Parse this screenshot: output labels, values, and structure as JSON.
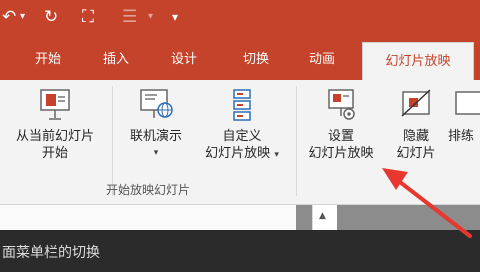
{
  "quick_access": {
    "undo_icon": "↶",
    "menu_caret": "▾",
    "redo_icon": "↻",
    "present_icon": "⛶",
    "list_icon": "☰",
    "customize_icon": "▾"
  },
  "tabs": [
    {
      "label": "开始"
    },
    {
      "label": "插入"
    },
    {
      "label": "设计"
    },
    {
      "label": "切换"
    },
    {
      "label": "动画"
    },
    {
      "label": "幻灯片放映",
      "active": true
    }
  ],
  "ribbon": {
    "from_current": {
      "line1": "从当前幻灯片",
      "line2": "开始"
    },
    "online": {
      "line1": "联机演示",
      "caret": "▾"
    },
    "custom": {
      "line1": "自定义",
      "line2": "幻灯片放映",
      "caret": "▾"
    },
    "setup": {
      "line1": "设置",
      "line2": "幻灯片放映"
    },
    "hide": {
      "line1": "隐藏",
      "line2": "幻灯片"
    },
    "rehearse": {
      "line1": "排练"
    },
    "group_label": "开始放映幻灯片"
  },
  "bottom": {
    "text": "面菜单栏的切换"
  },
  "colors": {
    "accent": "#c5432b",
    "arrow": "#e8372f"
  }
}
